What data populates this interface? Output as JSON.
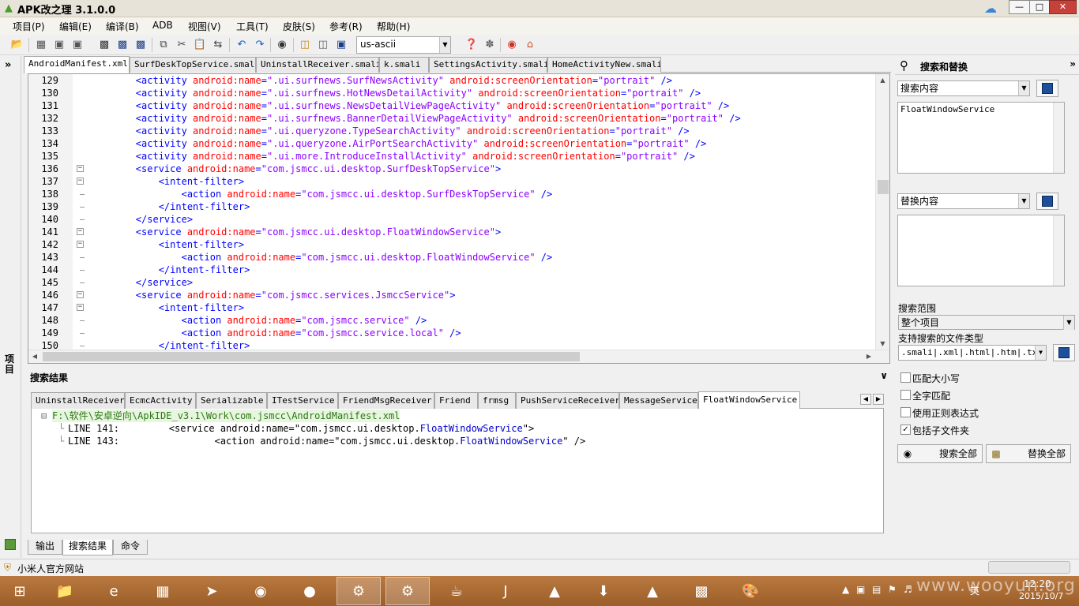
{
  "window": {
    "title": "APK改之理 3.1.0.0",
    "minimize": "—",
    "maximize": "□",
    "close": "✕"
  },
  "menu": [
    "项目(P)",
    "编辑(E)",
    "编译(B)",
    "ADB",
    "视图(V)",
    "工具(T)",
    "皮肤(S)",
    "参考(R)",
    "帮助(H)"
  ],
  "toolbar": {
    "encoding": "us-ascii",
    "icons": [
      "open-folder-icon",
      "grid-icon",
      "window-icon",
      "window-icon",
      "save-icon",
      "save-all-icon",
      "save-as-icon",
      "copy-icon",
      "cut-icon",
      "paste-icon",
      "replace-icon",
      "undo-icon",
      "redo-icon",
      "find-icon",
      "import-icon",
      "export-icon",
      "build-icon",
      "help-icon",
      "bug-icon",
      "weibo-icon",
      "home-icon"
    ]
  },
  "left_strip": {
    "chevron": "»",
    "label": "项目"
  },
  "editor_tabs": [
    "AndroidManifest.xml",
    "SurfDeskTopService.smali",
    "UninstallReceiver.smali",
    "k.smali",
    "SettingsActivity.smali",
    "HomeActivityNew.smali"
  ],
  "editor_active_tab": "AndroidManifest.xml",
  "code_lines": [
    {
      "n": "129",
      "fold": "",
      "indent": "        ",
      "parts": [
        [
          "tag",
          "<activity "
        ],
        [
          "attr",
          "android:name"
        ],
        [
          "punct",
          "="
        ],
        [
          "val",
          "\".ui.surfnews.SurfNewsActivity\""
        ],
        [
          "punct",
          " "
        ],
        [
          "attr",
          "android:screenOrientation"
        ],
        [
          "punct",
          "="
        ],
        [
          "val",
          "\"portrait\""
        ],
        [
          "punct",
          " />"
        ]
      ]
    },
    {
      "n": "130",
      "fold": "",
      "indent": "        ",
      "parts": [
        [
          "tag",
          "<activity "
        ],
        [
          "attr",
          "android:name"
        ],
        [
          "punct",
          "="
        ],
        [
          "val",
          "\".ui.surfnews.HotNewsDetailActivity\""
        ],
        [
          "punct",
          " "
        ],
        [
          "attr",
          "android:screenOrientation"
        ],
        [
          "punct",
          "="
        ],
        [
          "val",
          "\"portrait\""
        ],
        [
          "punct",
          " />"
        ]
      ]
    },
    {
      "n": "131",
      "fold": "",
      "indent": "        ",
      "parts": [
        [
          "tag",
          "<activity "
        ],
        [
          "attr",
          "android:name"
        ],
        [
          "punct",
          "="
        ],
        [
          "val",
          "\".ui.surfnews.NewsDetailViewPageActivity\""
        ],
        [
          "punct",
          " "
        ],
        [
          "attr",
          "android:screenOrientation"
        ],
        [
          "punct",
          "="
        ],
        [
          "val",
          "\"portrait\""
        ],
        [
          "punct",
          " />"
        ]
      ]
    },
    {
      "n": "132",
      "fold": "",
      "indent": "        ",
      "parts": [
        [
          "tag",
          "<activity "
        ],
        [
          "attr",
          "android:name"
        ],
        [
          "punct",
          "="
        ],
        [
          "val",
          "\".ui.surfnews.BannerDetailViewPageActivity\""
        ],
        [
          "punct",
          " "
        ],
        [
          "attr",
          "android:screenOrientation"
        ],
        [
          "punct",
          "="
        ],
        [
          "val",
          "\"portrait\""
        ],
        [
          "punct",
          " />"
        ]
      ]
    },
    {
      "n": "133",
      "fold": "",
      "indent": "        ",
      "parts": [
        [
          "tag",
          "<activity "
        ],
        [
          "attr",
          "android:name"
        ],
        [
          "punct",
          "="
        ],
        [
          "val",
          "\".ui.queryzone.TypeSearchActivity\""
        ],
        [
          "punct",
          " "
        ],
        [
          "attr",
          "android:screenOrientation"
        ],
        [
          "punct",
          "="
        ],
        [
          "val",
          "\"portrait\""
        ],
        [
          "punct",
          " />"
        ]
      ]
    },
    {
      "n": "134",
      "fold": "",
      "indent": "        ",
      "parts": [
        [
          "tag",
          "<activity "
        ],
        [
          "attr",
          "android:name"
        ],
        [
          "punct",
          "="
        ],
        [
          "val",
          "\".ui.queryzone.AirPortSearchActivity\""
        ],
        [
          "punct",
          " "
        ],
        [
          "attr",
          "android:screenOrientation"
        ],
        [
          "punct",
          "="
        ],
        [
          "val",
          "\"portrait\""
        ],
        [
          "punct",
          " />"
        ]
      ]
    },
    {
      "n": "135",
      "fold": "",
      "indent": "        ",
      "parts": [
        [
          "tag",
          "<activity "
        ],
        [
          "attr",
          "android:name"
        ],
        [
          "punct",
          "="
        ],
        [
          "val",
          "\".ui.more.IntroduceInstallActivity\""
        ],
        [
          "punct",
          " "
        ],
        [
          "attr",
          "android:screenOrientation"
        ],
        [
          "punct",
          "="
        ],
        [
          "val",
          "\"portrait\""
        ],
        [
          "punct",
          " />"
        ]
      ]
    },
    {
      "n": "136",
      "fold": "box",
      "indent": "        ",
      "parts": [
        [
          "tag",
          "<service "
        ],
        [
          "attr",
          "android:name"
        ],
        [
          "punct",
          "="
        ],
        [
          "val",
          "\"com.jsmcc.ui.desktop.SurfDeskTopService\""
        ],
        [
          "punct",
          ">"
        ]
      ]
    },
    {
      "n": "137",
      "fold": "box",
      "indent": "            ",
      "parts": [
        [
          "tag",
          "<intent-filter>"
        ]
      ]
    },
    {
      "n": "138",
      "fold": "line",
      "indent": "                ",
      "parts": [
        [
          "tag",
          "<action "
        ],
        [
          "attr",
          "android:name"
        ],
        [
          "punct",
          "="
        ],
        [
          "val",
          "\"com.jsmcc.ui.desktop.SurfDeskTopService\""
        ],
        [
          "punct",
          " />"
        ]
      ]
    },
    {
      "n": "139",
      "fold": "end",
      "indent": "            ",
      "parts": [
        [
          "tag",
          "</intent-filter>"
        ]
      ]
    },
    {
      "n": "140",
      "fold": "end",
      "indent": "        ",
      "parts": [
        [
          "tag",
          "</service>"
        ]
      ]
    },
    {
      "n": "141",
      "fold": "box",
      "indent": "        ",
      "parts": [
        [
          "tag",
          "<service "
        ],
        [
          "attr",
          "android:name"
        ],
        [
          "punct",
          "="
        ],
        [
          "val",
          "\"com.jsmcc.ui.desktop.FloatWindowService\""
        ],
        [
          "punct",
          ">"
        ]
      ]
    },
    {
      "n": "142",
      "fold": "box",
      "indent": "            ",
      "parts": [
        [
          "tag",
          "<intent-filter>"
        ]
      ]
    },
    {
      "n": "143",
      "fold": "line",
      "indent": "                ",
      "parts": [
        [
          "tag",
          "<action "
        ],
        [
          "attr",
          "android:name"
        ],
        [
          "punct",
          "="
        ],
        [
          "val",
          "\"com.jsmcc.ui.desktop.FloatWindowService\""
        ],
        [
          "punct",
          " />"
        ]
      ]
    },
    {
      "n": "144",
      "fold": "end",
      "indent": "            ",
      "parts": [
        [
          "tag",
          "</intent-filter>"
        ]
      ]
    },
    {
      "n": "145",
      "fold": "end",
      "indent": "        ",
      "parts": [
        [
          "tag",
          "</service>"
        ]
      ]
    },
    {
      "n": "146",
      "fold": "box",
      "indent": "        ",
      "parts": [
        [
          "tag",
          "<service "
        ],
        [
          "attr",
          "android:name"
        ],
        [
          "punct",
          "="
        ],
        [
          "val",
          "\"com.jsmcc.services.JsmccService\""
        ],
        [
          "punct",
          ">"
        ]
      ]
    },
    {
      "n": "147",
      "fold": "box",
      "indent": "            ",
      "parts": [
        [
          "tag",
          "<intent-filter>"
        ]
      ]
    },
    {
      "n": "148",
      "fold": "line",
      "indent": "                ",
      "parts": [
        [
          "tag",
          "<action "
        ],
        [
          "attr",
          "android:name"
        ],
        [
          "punct",
          "="
        ],
        [
          "val",
          "\"com.jsmcc.service\""
        ],
        [
          "punct",
          " />"
        ]
      ]
    },
    {
      "n": "149",
      "fold": "line",
      "indent": "                ",
      "parts": [
        [
          "tag",
          "<action "
        ],
        [
          "attr",
          "android:name"
        ],
        [
          "punct",
          "="
        ],
        [
          "val",
          "\"com.jsmcc.service.local\""
        ],
        [
          "punct",
          " />"
        ]
      ]
    },
    {
      "n": "150",
      "fold": "end",
      "indent": "            ",
      "parts": [
        [
          "tag",
          "</intent-filter>"
        ]
      ]
    }
  ],
  "results": {
    "header": "搜索结果",
    "tabs": [
      "UninstallReceiver",
      "EcmcActivity",
      "Serializable",
      "ITestService",
      "FriendMsgReceiver",
      "Friend",
      "frmsg",
      "PushServiceReceiver",
      "MessageService",
      "FloatWindowService"
    ],
    "active_tab": "FloatWindowService",
    "file_path": "F:\\软件\\安卓逆向\\ApkIDE_v3.1\\Work\\com.jsmcc\\AndroidManifest.xml",
    "lines": [
      {
        "label": "LINE 141:",
        "pre": "        <service android:name=\"com.jsmcc.ui.desktop.",
        "hit": "FloatWindowService",
        "post": "\">"
      },
      {
        "label": "LINE 143:",
        "pre": "                <action android:name=\"com.jsmcc.ui.desktop.",
        "hit": "FloatWindowService",
        "post": "\" />"
      }
    ]
  },
  "bottom_tabs": [
    "输出",
    "搜索结果",
    "命令"
  ],
  "bottom_active_tab": "搜索结果",
  "search_panel": {
    "title": "搜索和替换",
    "search_combo": "搜索内容",
    "search_text": "FloatWindowService",
    "replace_combo": "替换内容",
    "replace_text": "",
    "scope_label": "搜索范围",
    "scope_value": "整个项目",
    "filetype_label": "支持搜索的文件类型",
    "filetype_value": ".smali|.xml|.html|.htm|.txt",
    "options": [
      {
        "label": "匹配大小写",
        "checked": false
      },
      {
        "label": "全字匹配",
        "checked": false
      },
      {
        "label": "使用正则表达式",
        "checked": false
      },
      {
        "label": "包括子文件夹",
        "checked": true
      }
    ],
    "search_all": "搜索全部",
    "replace_all": "替换全部"
  },
  "status": {
    "text": "小米人官方网站"
  },
  "taskbar": {
    "apps": [
      "start-icon",
      "file-explorer-icon",
      "ie-icon",
      "store-icon",
      "feige-icon",
      "netease-music-icon",
      "firefox-icon",
      "android-ide-icon",
      "android-ide-es-icon",
      "java-cup-icon",
      "jd-icon",
      "hat-icon",
      "download-icon",
      "android-icon",
      "cmd-icon",
      "paint-icon"
    ],
    "ime": "英",
    "time": "12:20",
    "date": "2015/10/7",
    "watermark": "www.wooyun.org"
  },
  "colors": {
    "tag": "#0000ff",
    "attr": "#ff0000",
    "value": "#8b00ff",
    "hit": "#0000cc",
    "taskbar": "#b9793f"
  }
}
